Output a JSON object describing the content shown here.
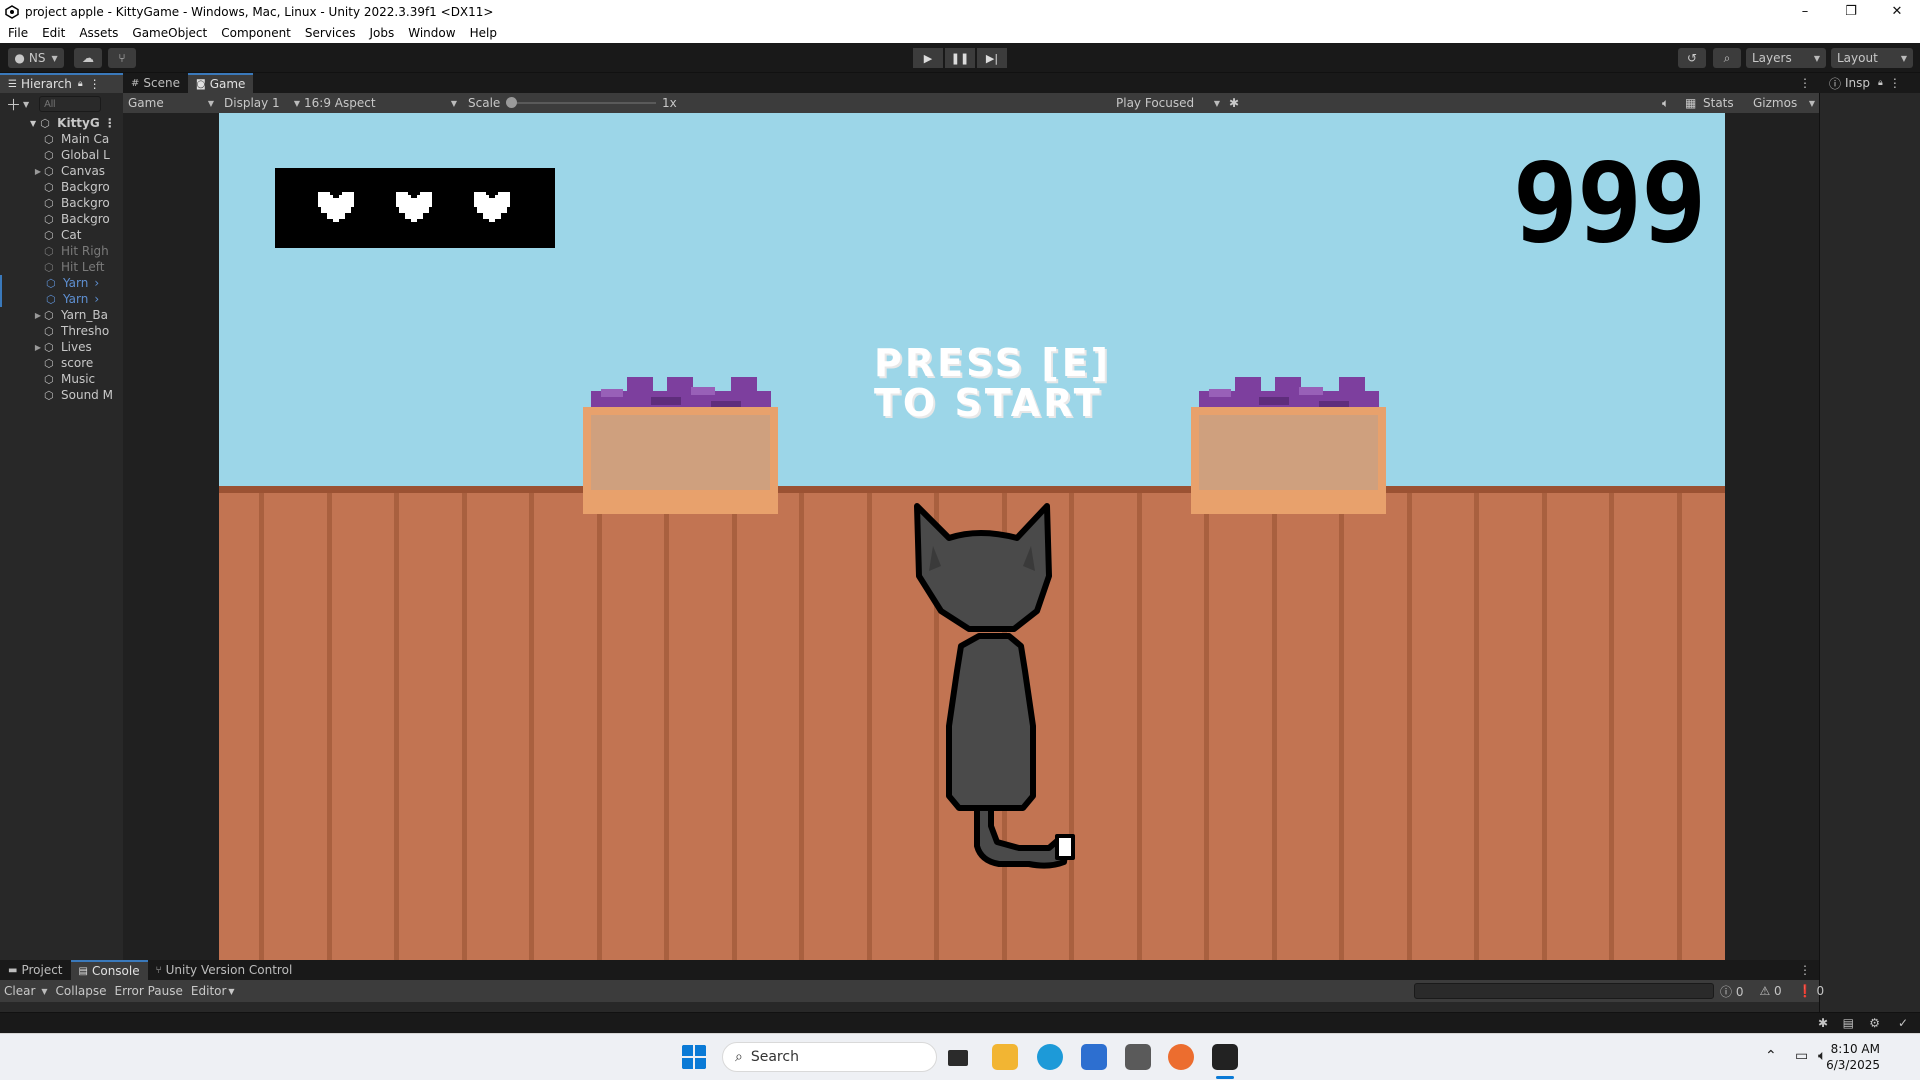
{
  "window": {
    "title": "project apple - KittyGame - Windows, Mac, Linux - Unity 2022.3.39f1 <DX11>",
    "controls": [
      "–",
      "❐",
      "✕"
    ]
  },
  "menu": [
    "File",
    "Edit",
    "Assets",
    "GameObject",
    "Component",
    "Services",
    "Jobs",
    "Window",
    "Help"
  ],
  "toolbar": {
    "account": "NS",
    "layers": "Layers",
    "layout": "Layout"
  },
  "tabs": {
    "hierarchy": "Hierarch",
    "scene": "Scene",
    "game": "Game",
    "inspector": "Insp"
  },
  "hierarchy": {
    "search_placeholder": "All",
    "scene_name": "KittyG",
    "items": [
      {
        "label": "Main Ca",
        "state": "normal",
        "expand": false
      },
      {
        "label": "Global L",
        "state": "normal",
        "expand": false
      },
      {
        "label": "Canvas",
        "state": "normal",
        "expand": true
      },
      {
        "label": "Backgro",
        "state": "normal",
        "expand": false
      },
      {
        "label": "Backgro",
        "state": "normal",
        "expand": false
      },
      {
        "label": "Backgro",
        "state": "normal",
        "expand": false
      },
      {
        "label": "Cat",
        "state": "normal",
        "expand": false
      },
      {
        "label": "Hit Righ",
        "state": "disabled",
        "expand": false
      },
      {
        "label": "Hit Left",
        "state": "disabled",
        "expand": false
      },
      {
        "label": "Yarn",
        "state": "prefab",
        "expand": false
      },
      {
        "label": "Yarn",
        "state": "prefab",
        "expand": false
      },
      {
        "label": "Yarn_Ba",
        "state": "normal",
        "expand": true
      },
      {
        "label": "Thresho",
        "state": "normal",
        "expand": false
      },
      {
        "label": "Lives",
        "state": "normal",
        "expand": true
      },
      {
        "label": "score",
        "state": "normal",
        "expand": false
      },
      {
        "label": "Music",
        "state": "normal",
        "expand": false
      },
      {
        "label": "Sound M",
        "state": "normal",
        "expand": false
      }
    ]
  },
  "game_header": {
    "view": "Game",
    "display": "Display 1",
    "aspect": "16:9 Aspect",
    "scale_label": "Scale",
    "scale_value": "1x",
    "play_mode": "Play Focused",
    "stats": "Stats",
    "gizmos": "Gizmos"
  },
  "game": {
    "lives": 3,
    "score": "999",
    "prompt_line1": "PRESS [E]",
    "prompt_line2": "TO START",
    "colors": {
      "sky": "#9cd6e8",
      "fence": "#c27452",
      "cat": "#4a4a4a",
      "berries": "#7d3f9e"
    }
  },
  "bottom": {
    "tabs": [
      "Project",
      "Console",
      "Unity Version Control"
    ],
    "active_tab": "Console",
    "console_buttons": [
      "Clear",
      "Collapse",
      "Error Pause",
      "Editor"
    ],
    "counts": {
      "log": "0",
      "warn": "0",
      "error": "0"
    }
  },
  "taskbar": {
    "search": "Search",
    "time": "8:10 AM",
    "date": "6/3/2025"
  }
}
